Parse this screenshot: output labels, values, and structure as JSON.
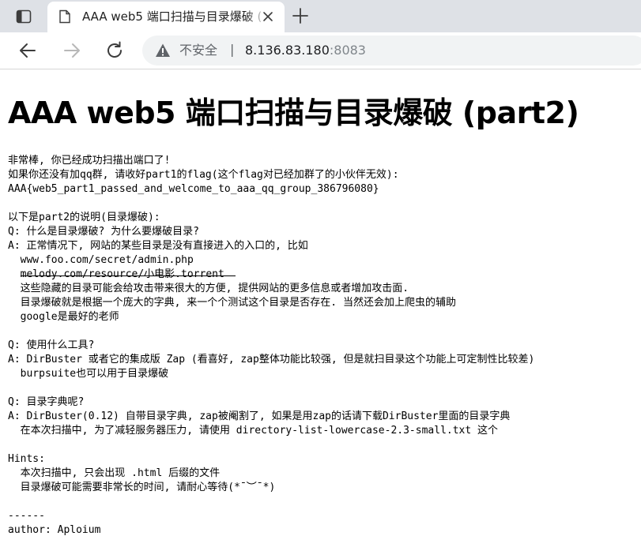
{
  "browser": {
    "tab_title": "AAA web5 端口扫描与目录爆破 (",
    "security_label": "不安全",
    "separator": "|",
    "url_host": "8.136.83.180",
    "url_port": ":8083",
    "icons": [
      "sidebar-icon",
      "page-icon",
      "close-icon",
      "plus-icon",
      "back-arrow-icon",
      "forward-arrow-icon",
      "reload-icon",
      "warning-icon"
    ]
  },
  "page": {
    "heading": "AAA web5 端口扫描与目录爆破 (part2)",
    "body": "非常棒, 你已经成功扫描出端口了!\n如果你还没有加qq群, 请收好part1的flag(这个flag对已经加群了的小伙伴无效):\nAAA{web5_part1_passed_and_welcome_to_aaa_qq_group_386796080}\n\n以下是part2的说明(目录爆破):\nQ: 什么是目录爆破? 为什么要爆破目录?\nA: 正常情况下, 网站的某些目录是没有直接进入的入口的, 比如\n  www.foo.com/secret/admin.php\n  melody.com/resource/小电影.torrent\n  这些隐藏的目录可能会给攻击带来很大的方便, 提供网站的更多信息或者增加攻击面.\n  目录爆破就是根据一个庞大的字典, 来一个个测试这个目录是否存在. 当然还会加上爬虫的辅助\n  google是最好的老师\n\nQ: 使用什么工具?\nA: DirBuster 或者它的集成版 Zap (看喜好, zap整体功能比较强, 但是就扫目录这个功能上可定制性比较差)\n  burpsuite也可以用于目录爆破\n\nQ: 目录字典呢?\nA: DirBuster(0.12) 自带目录字典, zap被阉割了, 如果是用zap的话请下载DirBuster里面的目录字典\n  在本次扫描中, 为了减轻服务器压力, 请使用 directory-list-lowercase-2.3-small.txt 这个\n\nHints:\n  本次扫描中, 只会出现 .html 后缀的文件\n  目录爆破可能需要非常长的时间, 请耐心等待(*¯︶¯*)\n\n------\nauthor: Aploium"
  }
}
